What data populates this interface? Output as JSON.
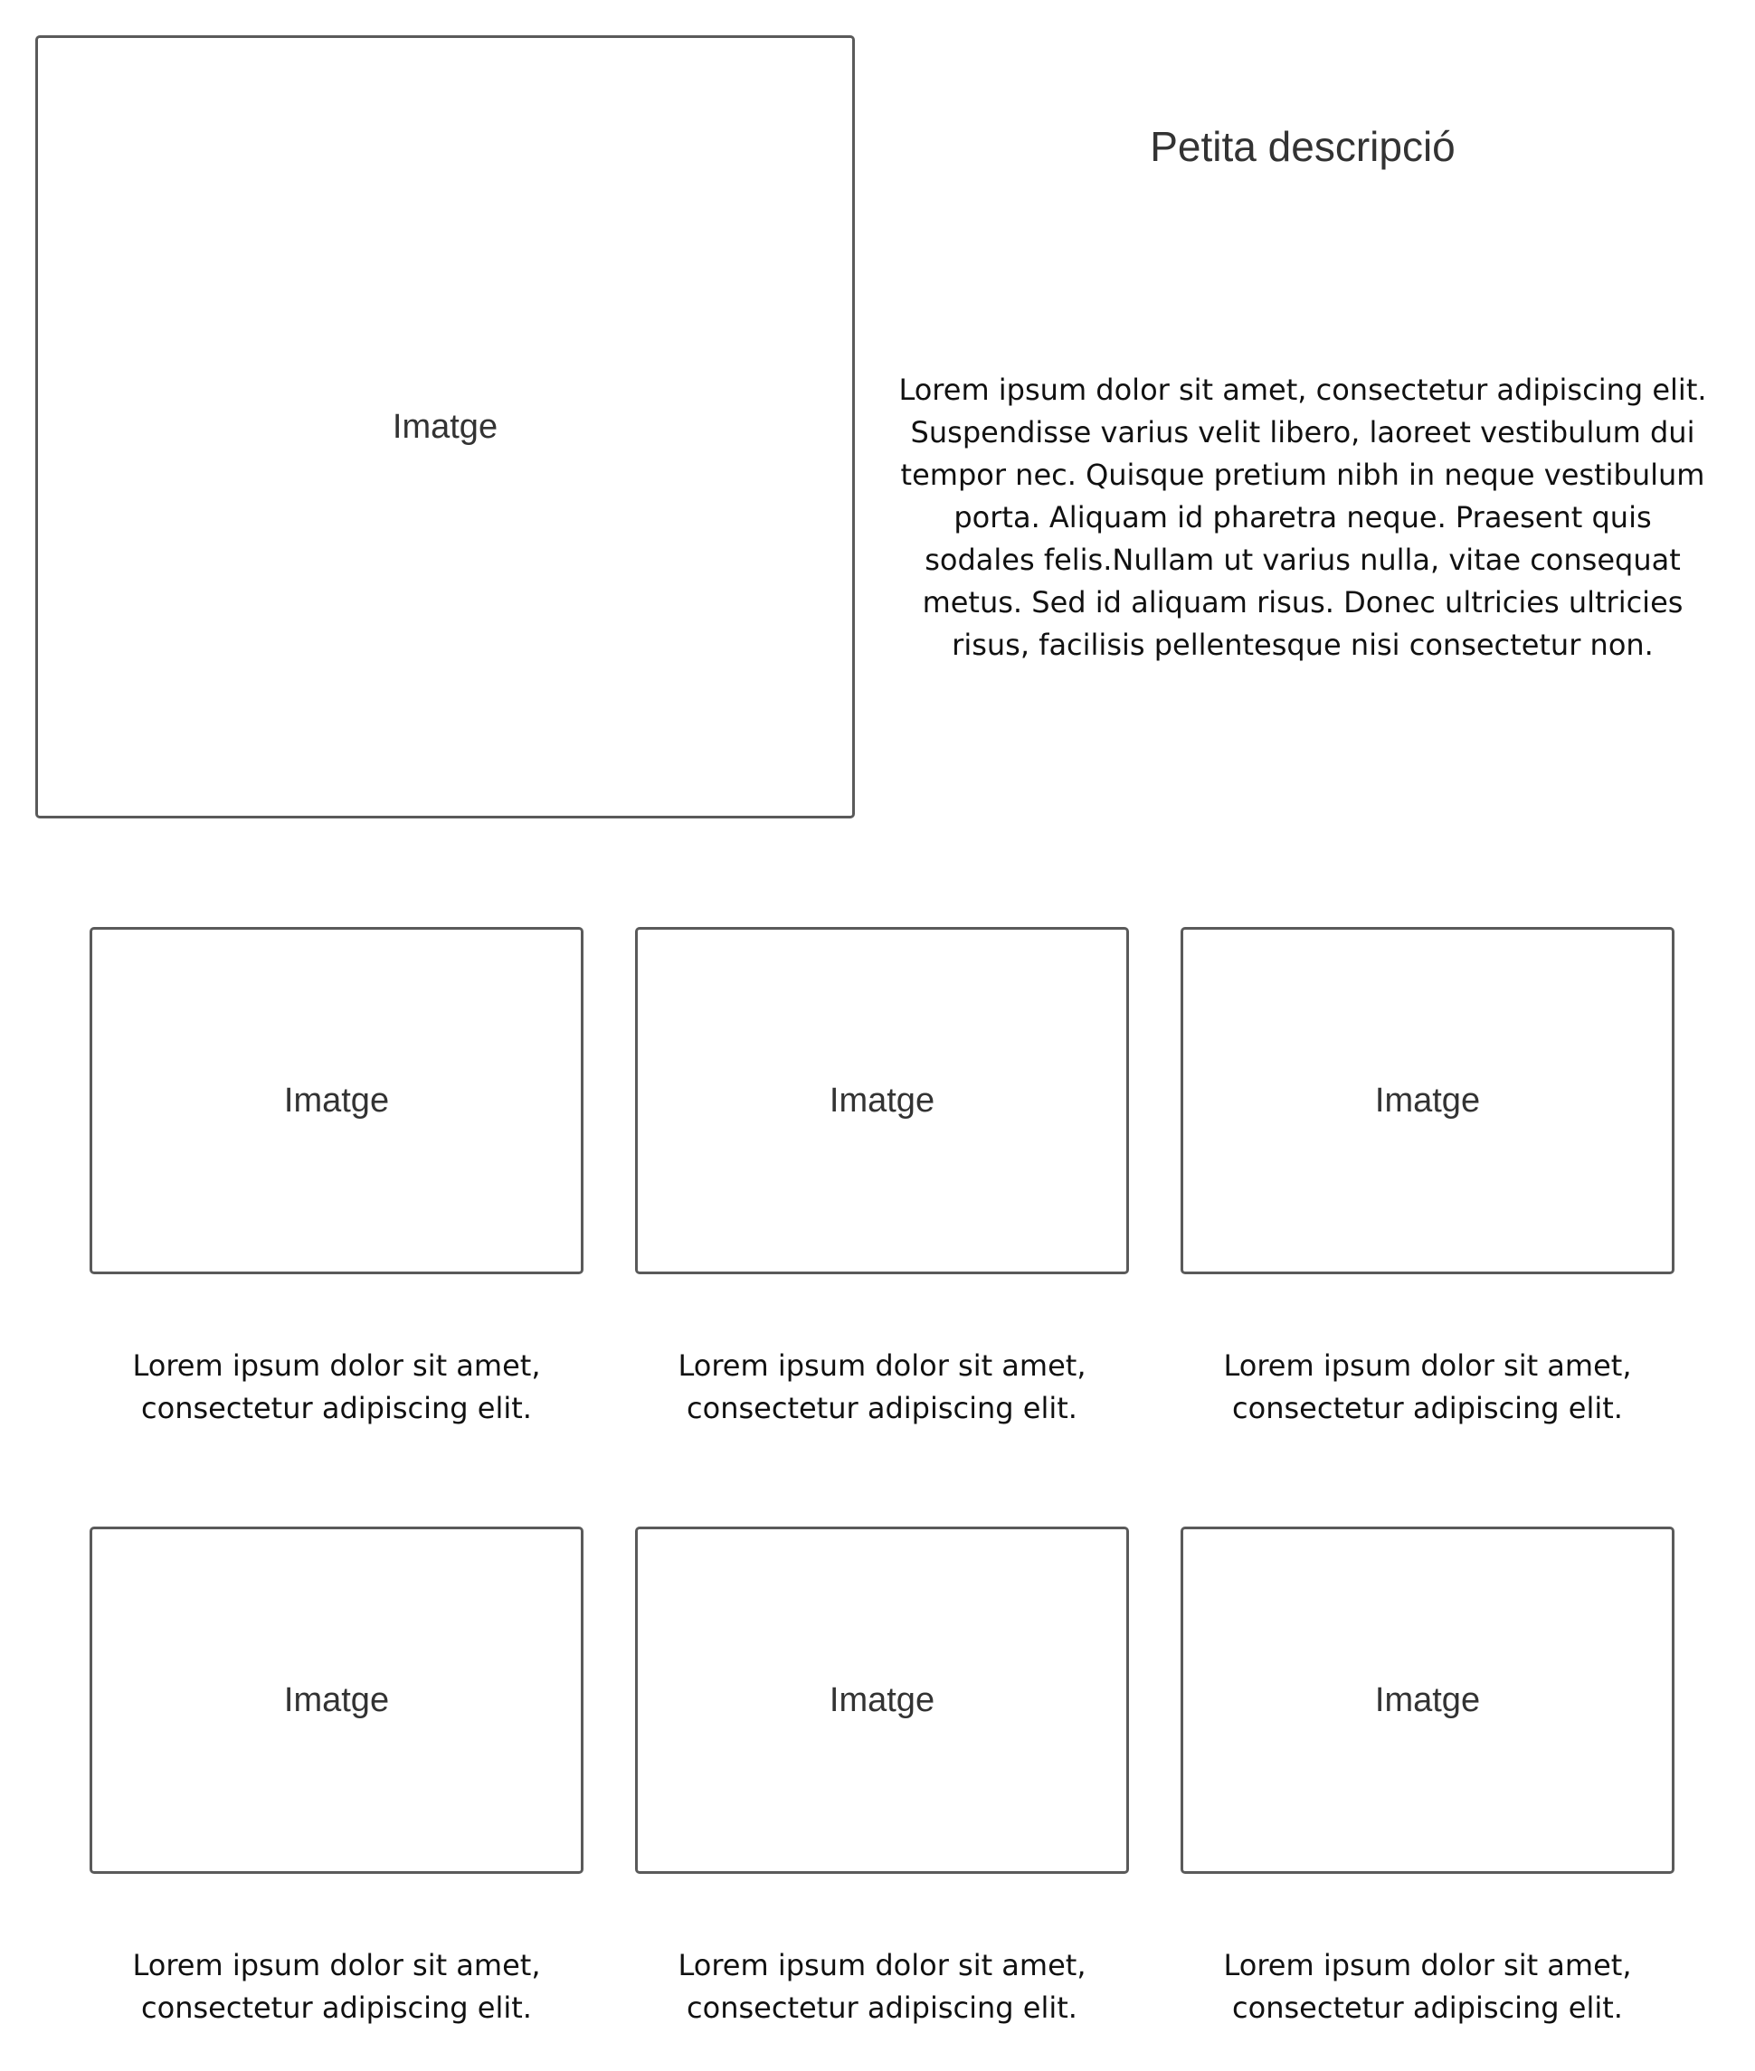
{
  "hero": {
    "image_label": "Imatge",
    "title": "Petita descripció",
    "description": "Lorem ipsum dolor sit amet, consectetur adipiscing elit. Suspendisse varius velit libero, laoreet vestibulum dui tempor nec. Quisque pretium nibh in neque vestibulum porta. Aliquam id pharetra neque. Praesent quis sodales felis.Nullam ut varius nulla, vitae consequat metus. Sed id aliquam risus. Donec ultricies ultricies risus, facilisis pellentesque nisi consectetur non."
  },
  "cards": [
    {
      "image_label": "Imatge",
      "caption": "Lorem ipsum dolor sit amet, consectetur adipiscing elit."
    },
    {
      "image_label": "Imatge",
      "caption": "Lorem ipsum dolor sit amet, consectetur adipiscing elit."
    },
    {
      "image_label": "Imatge",
      "caption": "Lorem ipsum dolor sit amet, consectetur adipiscing elit."
    },
    {
      "image_label": "Imatge",
      "caption": "Lorem ipsum dolor sit amet, consectetur adipiscing elit."
    },
    {
      "image_label": "Imatge",
      "caption": "Lorem ipsum dolor sit amet, consectetur adipiscing elit."
    },
    {
      "image_label": "Imatge",
      "caption": "Lorem ipsum dolor sit amet, consectetur adipiscing elit."
    }
  ],
  "colors": {
    "border": "#5a5a5a",
    "label_text": "#333333",
    "body_text": "#111111",
    "background": "#ffffff"
  }
}
